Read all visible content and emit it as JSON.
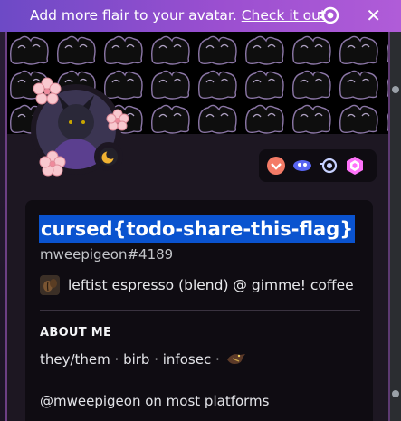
{
  "notice": {
    "text": "Add more flair to your avatar.",
    "link": "Check it out",
    "icon": "nitro-icon",
    "close_icon": "close-icon",
    "close_glyph": "✕"
  },
  "profile": {
    "display_name": "cursed{todo-share-this-flag}",
    "tag": "mweepigeon#4189",
    "status_emoji": "coffee-bean-emoji",
    "custom_status": "leftist espresso (blend) @ gimme! coffee",
    "status_indicator": "idle-moon-icon",
    "badges": [
      "hypesquad-icon",
      "server-boost-icon",
      "nitro-icon",
      "hypesquad-balance-icon"
    ]
  },
  "about": {
    "heading": "ABOUT ME",
    "line1": "they/them · birb · infosec ·",
    "line1_emoji": "bird-emoji",
    "line2": "@mweepigeon on most platforms"
  },
  "colors": {
    "notice_gradient_start": "#6d4ac6",
    "notice_gradient_end": "#b05cd8",
    "card_bg": "#1d1722",
    "inner_bg": "#0f0c12",
    "highlight": "#0a53cf"
  }
}
